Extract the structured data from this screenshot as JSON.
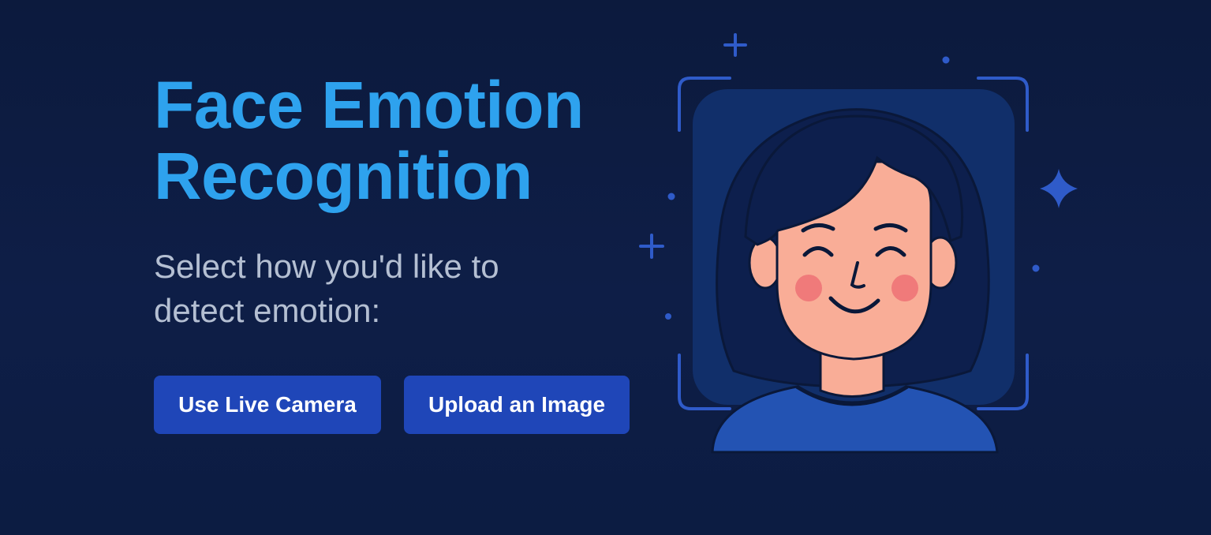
{
  "hero": {
    "title_line1": "Face Emotion",
    "title_line2": "Recognition",
    "subtitle": "Select how you'd like to detect emotion:"
  },
  "actions": {
    "camera_label": "Use Live Camera",
    "upload_label": "Upload an Image"
  },
  "illustration": {
    "icon": "smiling-face-scan-illustration"
  },
  "colors": {
    "background": "#0e1e47",
    "title": "#2ea2ee",
    "subtitle": "#b4bfd2",
    "button": "#1f46b8",
    "accent": "#2f5bc9"
  }
}
